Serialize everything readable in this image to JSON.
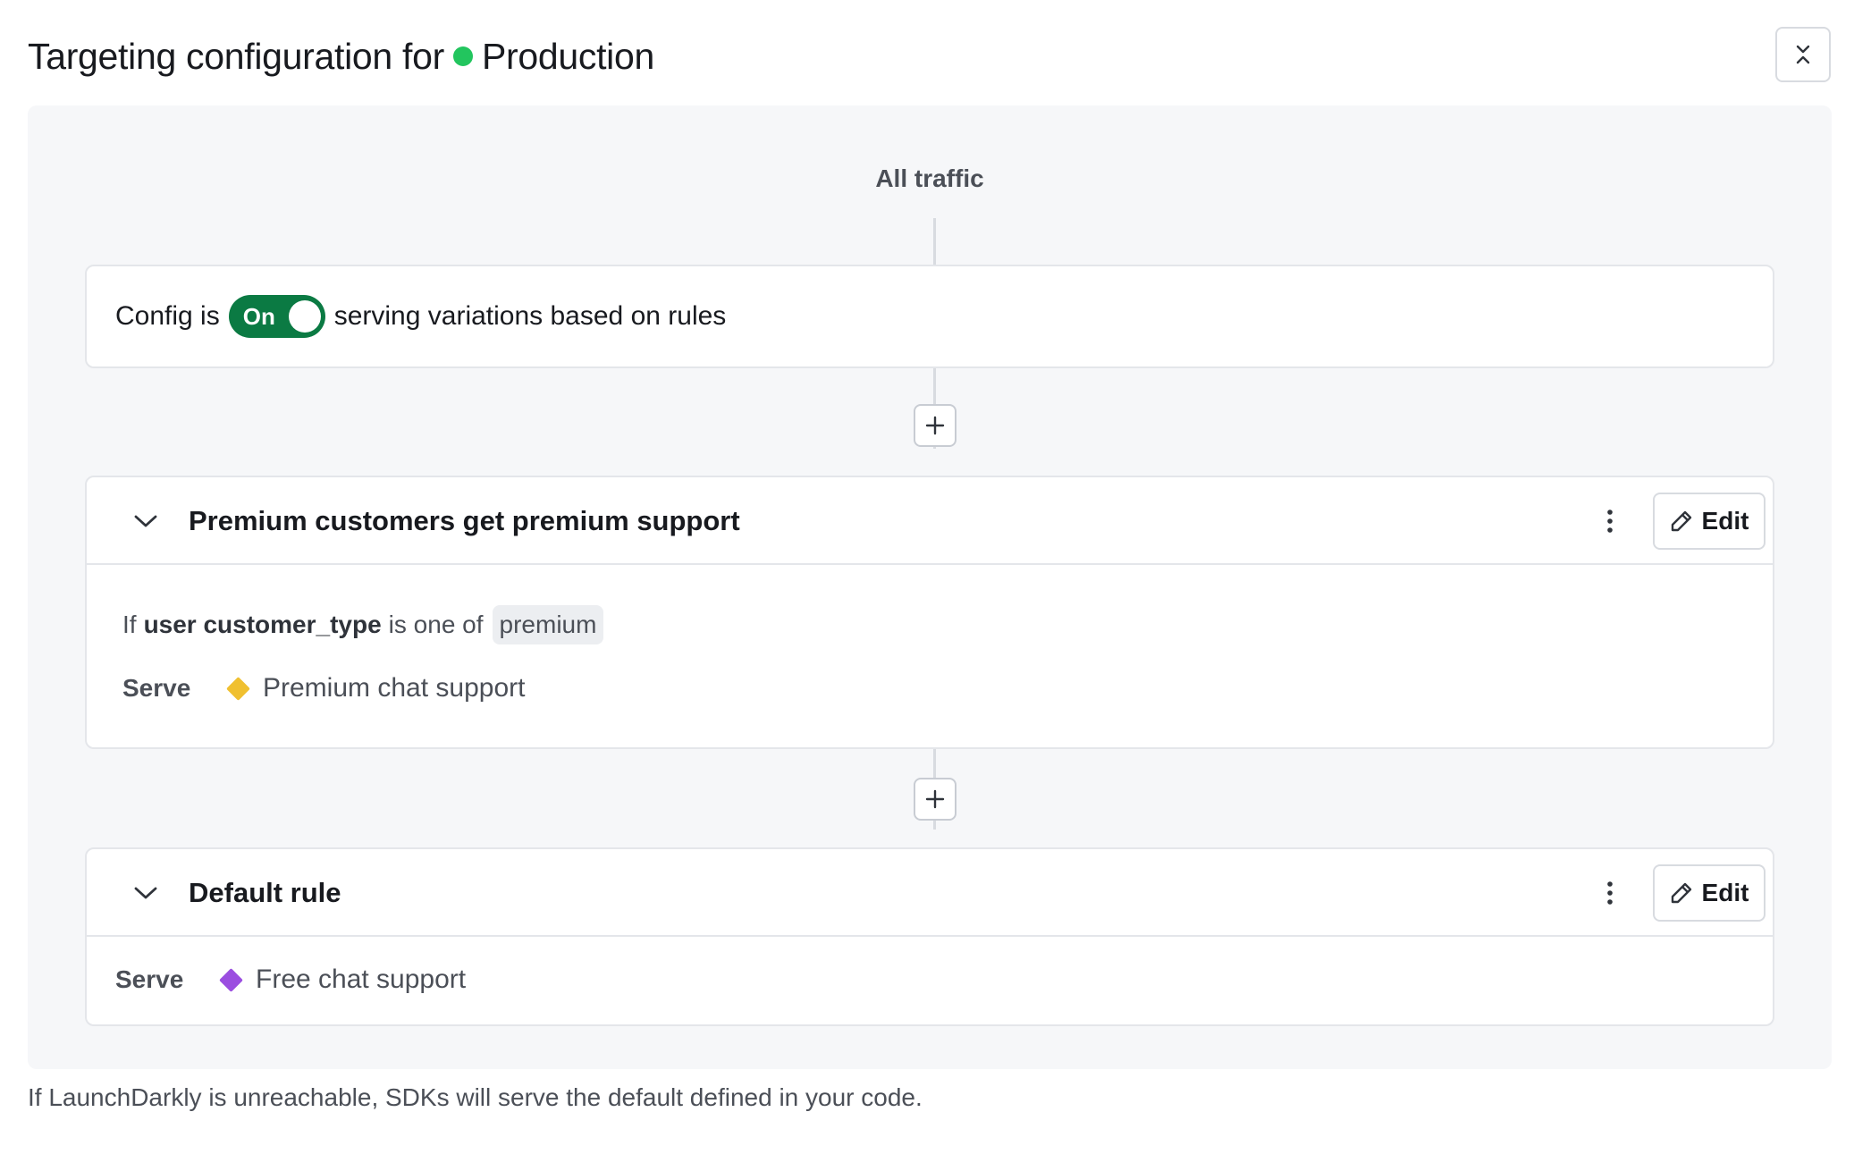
{
  "header": {
    "title_prefix": "Targeting configuration for",
    "environment_name": "Production",
    "environment_color": "#22c55e",
    "collapse_icon": "collapse-all-icon"
  },
  "flow": {
    "all_traffic_label": "All traffic",
    "status": {
      "prefix": "Config is",
      "toggle_label": "On",
      "toggle_color": "#0b7a43",
      "suffix": "serving variations based on rules"
    },
    "rules": [
      {
        "title": "Premium customers get premium support",
        "clause": {
          "if_label": "If",
          "attribute": "user customer_type",
          "operator": "is one of",
          "value": "premium"
        },
        "serve_label": "Serve",
        "variation_name": "Premium chat support",
        "variation_color": "#f0c030",
        "edit_label": "Edit"
      }
    ],
    "default_rule": {
      "title": "Default rule",
      "serve_label": "Serve",
      "variation_name": "Free chat support",
      "variation_color": "#9b4ee0",
      "edit_label": "Edit"
    }
  },
  "footnote": "If LaunchDarkly is unreachable, SDKs will serve the default defined in your code."
}
